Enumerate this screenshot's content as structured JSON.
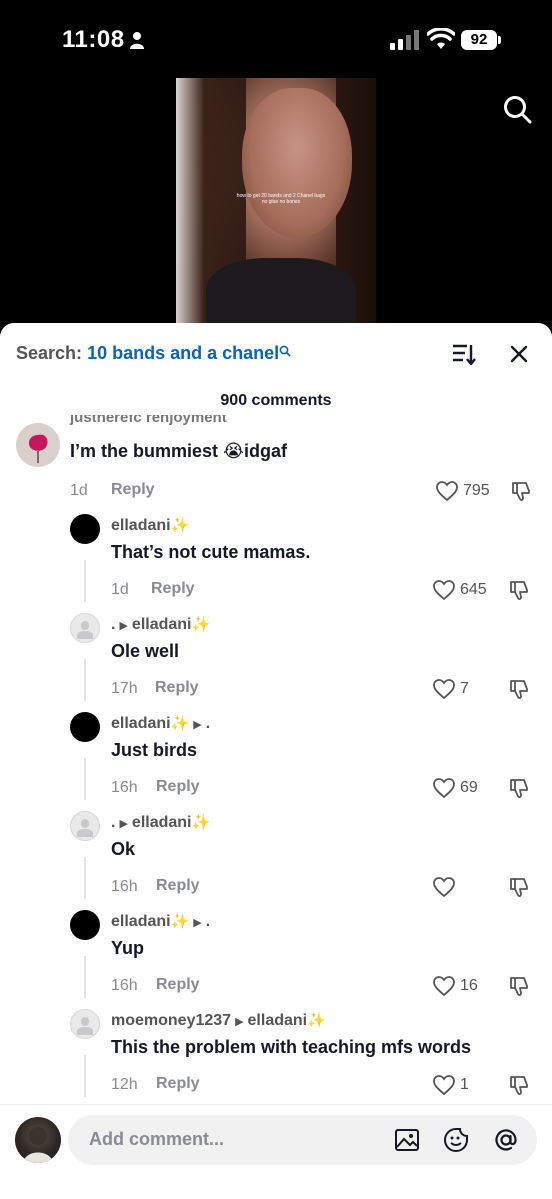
{
  "status_bar": {
    "time": "11:08",
    "battery": "92"
  },
  "video": {
    "caption_line1": "how to get 20 bands and 2 Chanel bags",
    "caption_line2": "no glue no bones"
  },
  "sheet": {
    "search_label": "Search:",
    "search_query": "10 bands and a chanel",
    "comment_count": "900 comments"
  },
  "comments": [
    {
      "username": "justherefc renjoyment",
      "text": "I’m the bummiest 😭idgaf",
      "time": "1d",
      "reply": "Reply",
      "likes": "795"
    },
    {
      "username": "elladani",
      "text": "That’s not cute mamas.",
      "time": "1d",
      "reply": "Reply",
      "likes": "645"
    },
    {
      "username": ".",
      "reply_to": "elladani",
      "text": "Ole well",
      "time": "17h",
      "reply": "Reply",
      "likes": "7"
    },
    {
      "username": "elladani",
      "reply_to": ".",
      "text": "Just birds",
      "time": "16h",
      "reply": "Reply",
      "likes": "69"
    },
    {
      "username": ".",
      "reply_to": "elladani",
      "text": "Ok",
      "time": "16h",
      "reply": "Reply",
      "likes": ""
    },
    {
      "username": "elladani",
      "reply_to": ".",
      "text": "Yup",
      "time": "16h",
      "reply": "Reply",
      "likes": "16"
    },
    {
      "username": "moemoney1237",
      "reply_to": "elladani",
      "text": "This the problem with teaching mfs words",
      "time": "12h",
      "reply": "Reply",
      "likes": "1"
    }
  ],
  "bottom_bar": {
    "placeholder": "Add comment..."
  },
  "icons": [
    "person-icon",
    "signal-icon",
    "wifi-icon",
    "search-icon",
    "sort-icon",
    "close-icon",
    "heart-icon",
    "dislike-icon",
    "image-icon",
    "emoji-icon",
    "mention-icon"
  ]
}
